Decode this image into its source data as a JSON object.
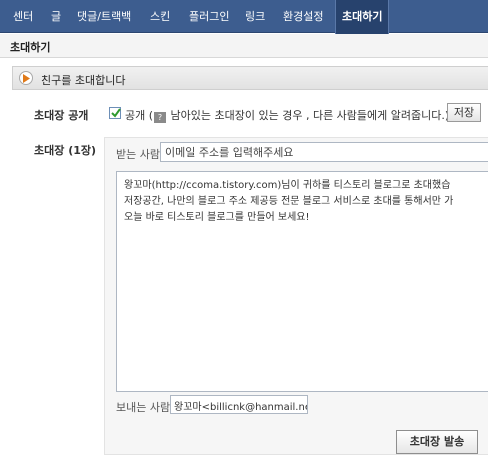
{
  "nav": {
    "items": [
      {
        "label": "센터"
      },
      {
        "label": "글"
      },
      {
        "label": "댓글/트랙백"
      },
      {
        "label": "스킨"
      },
      {
        "label": "플러그인"
      },
      {
        "label": "링크"
      },
      {
        "label": "환경설정"
      },
      {
        "label": "초대하기"
      }
    ],
    "active_index": 7
  },
  "page_title": "초대하기",
  "section_title": "친구를 초대합니다",
  "public": {
    "label": "초대장 공개",
    "checked": true,
    "checkbox_text": "공개 (",
    "icon_char": "?",
    "desc": "남아있는 초대장이 있는 경우 , 다른 사람들에게 알려줍니다.)",
    "save_button": "저장"
  },
  "invite": {
    "label": "초대장 (1장)",
    "recipient_label": "받는 사람",
    "recipient_value": "이메일 주소를 입력해주세요",
    "message_lines": [
      "왕꼬마(http://ccoma.tistory.com)님이 귀하를 티스토리 블로그로 초대했습",
      "저장공간, 나만의 블로그 주소 제공등 전문 블로그 서비스로 초대를 통해서만 가",
      "오늘 바로 티스토리 블로그를 만들어 보세요!"
    ],
    "sender_label": "보내는 사람",
    "sender_value": "왕꼬마<billicnk@hanmail.net>",
    "send_button": "초대장 발송"
  },
  "colors": {
    "nav_bg": "#3d5d8f",
    "nav_active_bg": "#27426d",
    "checkbox_check": "#2f9a2f"
  }
}
